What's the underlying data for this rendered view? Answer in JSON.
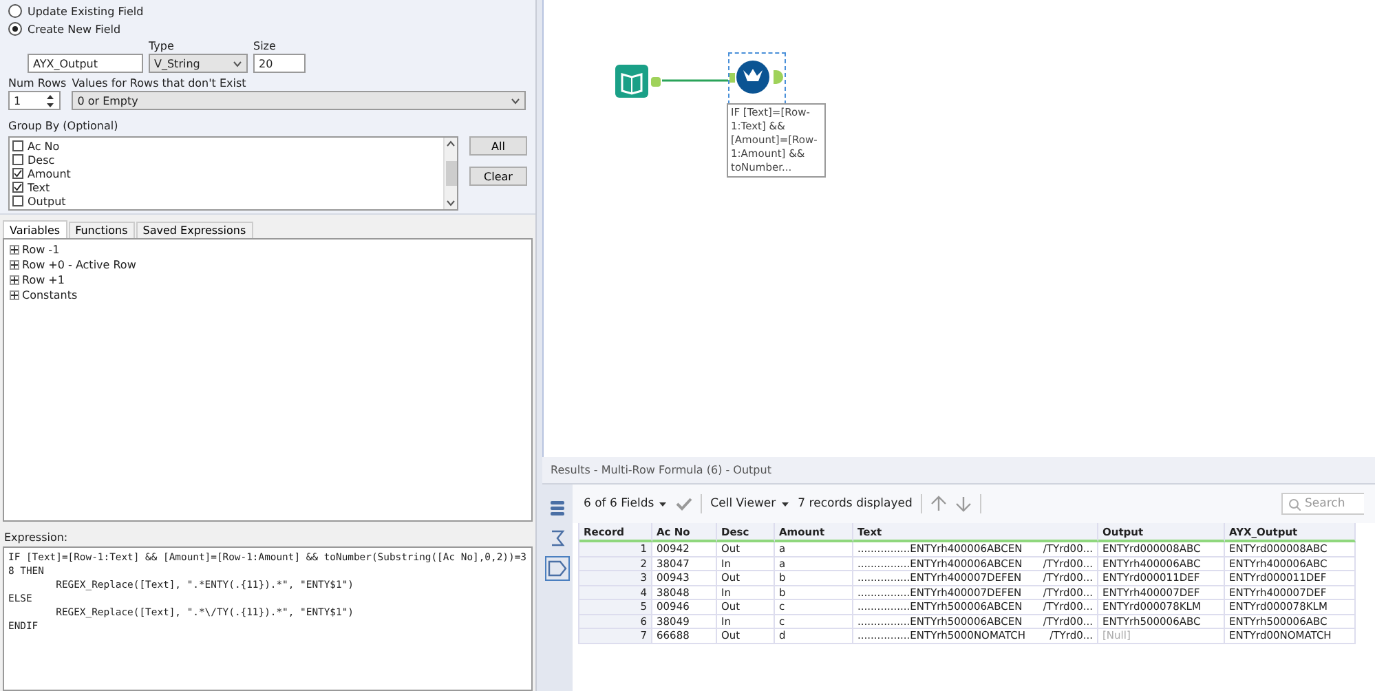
{
  "config": {
    "radios": [
      {
        "label": "Update Existing Field",
        "selected": false
      },
      {
        "label": "Create New  Field",
        "selected": true
      }
    ],
    "field_name": "AYX_Output",
    "type_label": "Type",
    "type_value": "V_String",
    "size_label": "Size",
    "size_value": "20",
    "num_rows_label": "Num Rows",
    "num_rows_value": "1",
    "missing_label": "Values for Rows that don't Exist",
    "missing_value": "0 or Empty",
    "group_by_label": "Group By (Optional)",
    "group_by": [
      {
        "label": "Ac No",
        "checked": false
      },
      {
        "label": "Desc",
        "checked": false
      },
      {
        "label": "Amount",
        "checked": true
      },
      {
        "label": "Text",
        "checked": true
      },
      {
        "label": "Output",
        "checked": false
      }
    ],
    "buttons": [
      "All",
      "Clear"
    ]
  },
  "tabs": [
    {
      "label": "Variables",
      "selected": true
    },
    {
      "label": "Functions",
      "selected": false
    },
    {
      "label": "Saved Expressions",
      "selected": false
    }
  ],
  "tree": [
    {
      "label": "Row -1",
      "expanded": false
    },
    {
      "label": "Row +0 - Active Row",
      "expanded": false
    },
    {
      "label": "Row +1",
      "expanded": false
    },
    {
      "label": "Constants",
      "expanded": false
    }
  ],
  "expression": {
    "label": "Expression:",
    "value": "IF [Text]=[Row-1:Text] && [Amount]=[Row-1:Amount] && toNumber(Substring([Ac No],0,2))=38 THEN\n\tREGEX_Replace([Text], \".*ENTY(.{11}).*\", \"ENTY$1\")\nELSE\n\tREGEX_Replace([Text], \".*\\/TY(.{11}).*\", \"ENTY$1\")\nENDIF"
  },
  "canvas": {
    "annotation": "IF [Text]=[Row-1:Text] && [Amount]=[Row-1:Amount] && toNumber..."
  },
  "results": {
    "title": "Results - Multi-Row Formula (6) - Output",
    "fields": "6 of 6 Fields",
    "viewer": "Cell Viewer",
    "count": "7 records displayed",
    "search_placeholder": "Search",
    "columns": [
      "Record",
      "Ac No",
      "Desc",
      "Amount",
      "Text",
      "Output",
      "AYX_Output"
    ],
    "rows": [
      {
        "record": "1",
        "ac_no": "00942",
        "desc": "Out",
        "amount": "a",
        "text": [
          "................ENTYrh400006ABCEN",
          "/TYrd00..."
        ],
        "output": "ENTYrd000008ABC",
        "output_null": false,
        "ayx_output": "ENTYrd000008ABC"
      },
      {
        "record": "2",
        "ac_no": "38047",
        "desc": "In",
        "amount": "a",
        "text": [
          "................ENTYrh400006ABCEN",
          "/TYrd00..."
        ],
        "output": "ENTYrh400006ABC",
        "output_null": false,
        "ayx_output": "ENTYrh400006ABC"
      },
      {
        "record": "3",
        "ac_no": "00943",
        "desc": "Out",
        "amount": "b",
        "text": [
          "................ENTYrh400007DEFEN",
          "/TYrd00..."
        ],
        "output": "ENTYrd000011DEF",
        "output_null": false,
        "ayx_output": "ENTYrd000011DEF"
      },
      {
        "record": "4",
        "ac_no": "38048",
        "desc": "In",
        "amount": "b",
        "text": [
          "................ENTYrh400007DEFEN",
          "/TYrd00..."
        ],
        "output": "ENTYrh400007DEF",
        "output_null": false,
        "ayx_output": "ENTYrh400007DEF"
      },
      {
        "record": "5",
        "ac_no": "00946",
        "desc": "Out",
        "amount": "c",
        "text": [
          "................ENTYrh500006ABCEN",
          "/TYrd00..."
        ],
        "output": "ENTYrd000078KLM",
        "output_null": false,
        "ayx_output": "ENTYrd000078KLM"
      },
      {
        "record": "6",
        "ac_no": "38049",
        "desc": "In",
        "amount": "c",
        "text": [
          "................ENTYrh500006ABCEN",
          "/TYrd00..."
        ],
        "output": "ENTYrh500006ABC",
        "output_null": false,
        "ayx_output": "ENTYrh500006ABC"
      },
      {
        "record": "7",
        "ac_no": "66688",
        "desc": "Out",
        "amount": "d",
        "text": [
          "................ENTYrh5000NOMATCH",
          "/TYrd0..."
        ],
        "output": "[Null]",
        "output_null": true,
        "ayx_output": "ENTYrd00NOMATCH"
      }
    ]
  }
}
